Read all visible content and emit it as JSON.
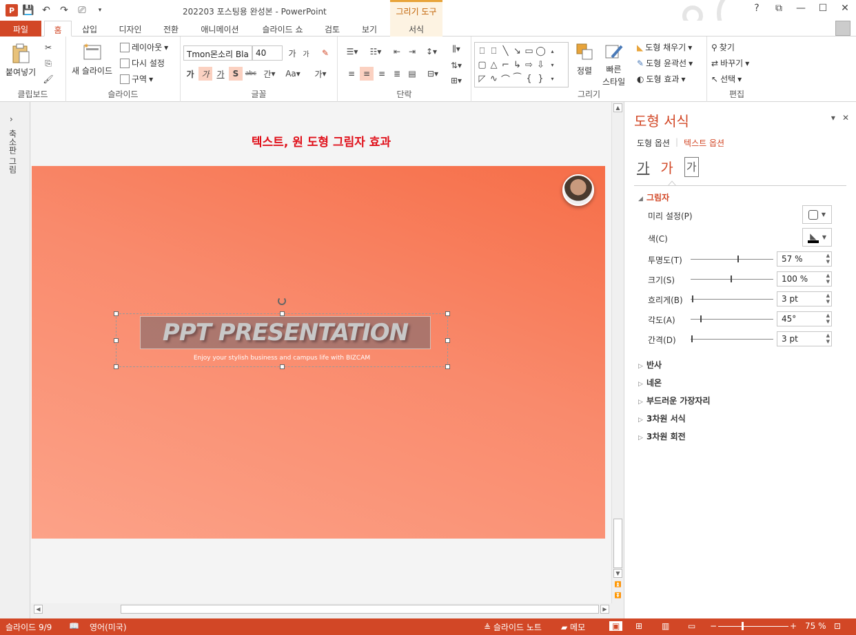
{
  "titlebar": {
    "doc_title": "202203 포스팅용 완성본 - PowerPoint",
    "context_tab": "그리기 도구",
    "help": "?",
    "restore_ribbon": "⧉",
    "minimize": "—",
    "maximize": "☐",
    "close": "✕"
  },
  "tabs": [
    "파일",
    "홈",
    "삽입",
    "디자인",
    "전환",
    "애니메이션",
    "슬라이드 쇼",
    "검토",
    "보기",
    "서식"
  ],
  "ribbon": {
    "clipboard": {
      "paste": "붙여넣기",
      "label": "클립보드"
    },
    "slides": {
      "new_slide": "새 슬라이드",
      "layout": "레이아웃",
      "reset": "다시 설정",
      "section": "구역",
      "label": "슬라이드"
    },
    "font": {
      "font_name": "Tmon몬소리 Bla",
      "font_size": "40",
      "label": "글꼴",
      "bold": "가",
      "italic": "가",
      "underline": "가",
      "shadow": "S",
      "strike": "abc",
      "spacing": "간",
      "case": "Aa",
      "color": "가"
    },
    "paragraph": {
      "label": "단락"
    },
    "drawing": {
      "arrange": "정렬",
      "quick_styles": "빠른",
      "quick_styles2": "스타일",
      "fill": "도형 채우기",
      "outline": "도형 윤곽선",
      "effects": "도형 효과",
      "label": "그리기"
    },
    "editing": {
      "find": "찾기",
      "replace": "바꾸기",
      "select": "선택",
      "label": "편집"
    }
  },
  "thumbnail_pane": {
    "label": "축소판 그림"
  },
  "slide": {
    "heading": "텍스트, 원 도형 그림자 효과",
    "title": "PPT PRESENTATION",
    "subtitle": "Enjoy your stylish business and campus life with BIZCAM"
  },
  "format_pane": {
    "title": "도형 서식",
    "tab_shape": "도형 옵션",
    "tab_text": "텍스트 옵션",
    "shadow_section": "그림자",
    "preset": "미리 설정(P)",
    "color": "색(C)",
    "props": [
      {
        "label": "투명도(T)",
        "value": "57 %"
      },
      {
        "label": "크기(S)",
        "value": "100 %"
      },
      {
        "label": "흐리게(B)",
        "value": "3 pt"
      },
      {
        "label": "각도(A)",
        "value": "45°"
      },
      {
        "label": "간격(D)",
        "value": "3 pt"
      }
    ],
    "sections": [
      "반사",
      "네온",
      "부드러운 가장자리",
      "3차원 서식",
      "3차원 회전"
    ]
  },
  "statusbar": {
    "slide_pos": "슬라이드 9/9",
    "language": "영어(미국)",
    "notes": "슬라이드 노트",
    "comments": "메모",
    "zoom": "75 %"
  },
  "colors": {
    "accent": "#d24726",
    "slide_grad_start": "#f66e48",
    "slide_grad_end": "#fca288",
    "heading": "#e0101a"
  }
}
